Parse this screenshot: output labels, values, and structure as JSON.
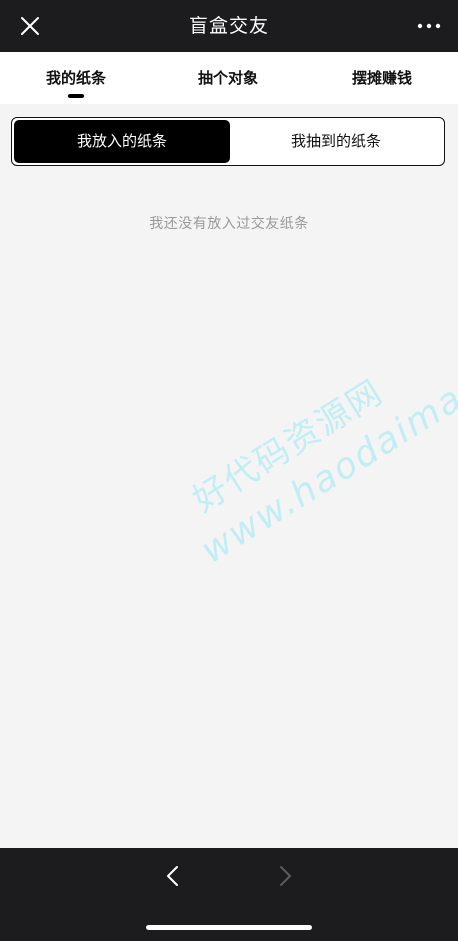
{
  "navbar": {
    "title": "盲盒交友",
    "close_icon": "close-icon",
    "more_icon": "more-icon"
  },
  "tabs": [
    {
      "label": "我的纸条",
      "active": true
    },
    {
      "label": "抽个对象",
      "active": false
    },
    {
      "label": "摆摊赚钱",
      "active": false
    }
  ],
  "segment": {
    "left_label": "我放入的纸条",
    "right_label": "我抽到的纸条",
    "selected": "left"
  },
  "content": {
    "empty_message": "我还没有放入过交友纸条"
  },
  "watermark": {
    "line1": "好代码资源网",
    "line2": "www.haodaima.cc"
  },
  "bottombar": {
    "back_icon": "chevron-left-icon",
    "forward_icon": "chevron-right-icon"
  },
  "colors": {
    "bar_background": "#1c1c1e",
    "page_background": "#f4f4f4",
    "accent": "#000000",
    "watermark": "#b9ecf5"
  }
}
